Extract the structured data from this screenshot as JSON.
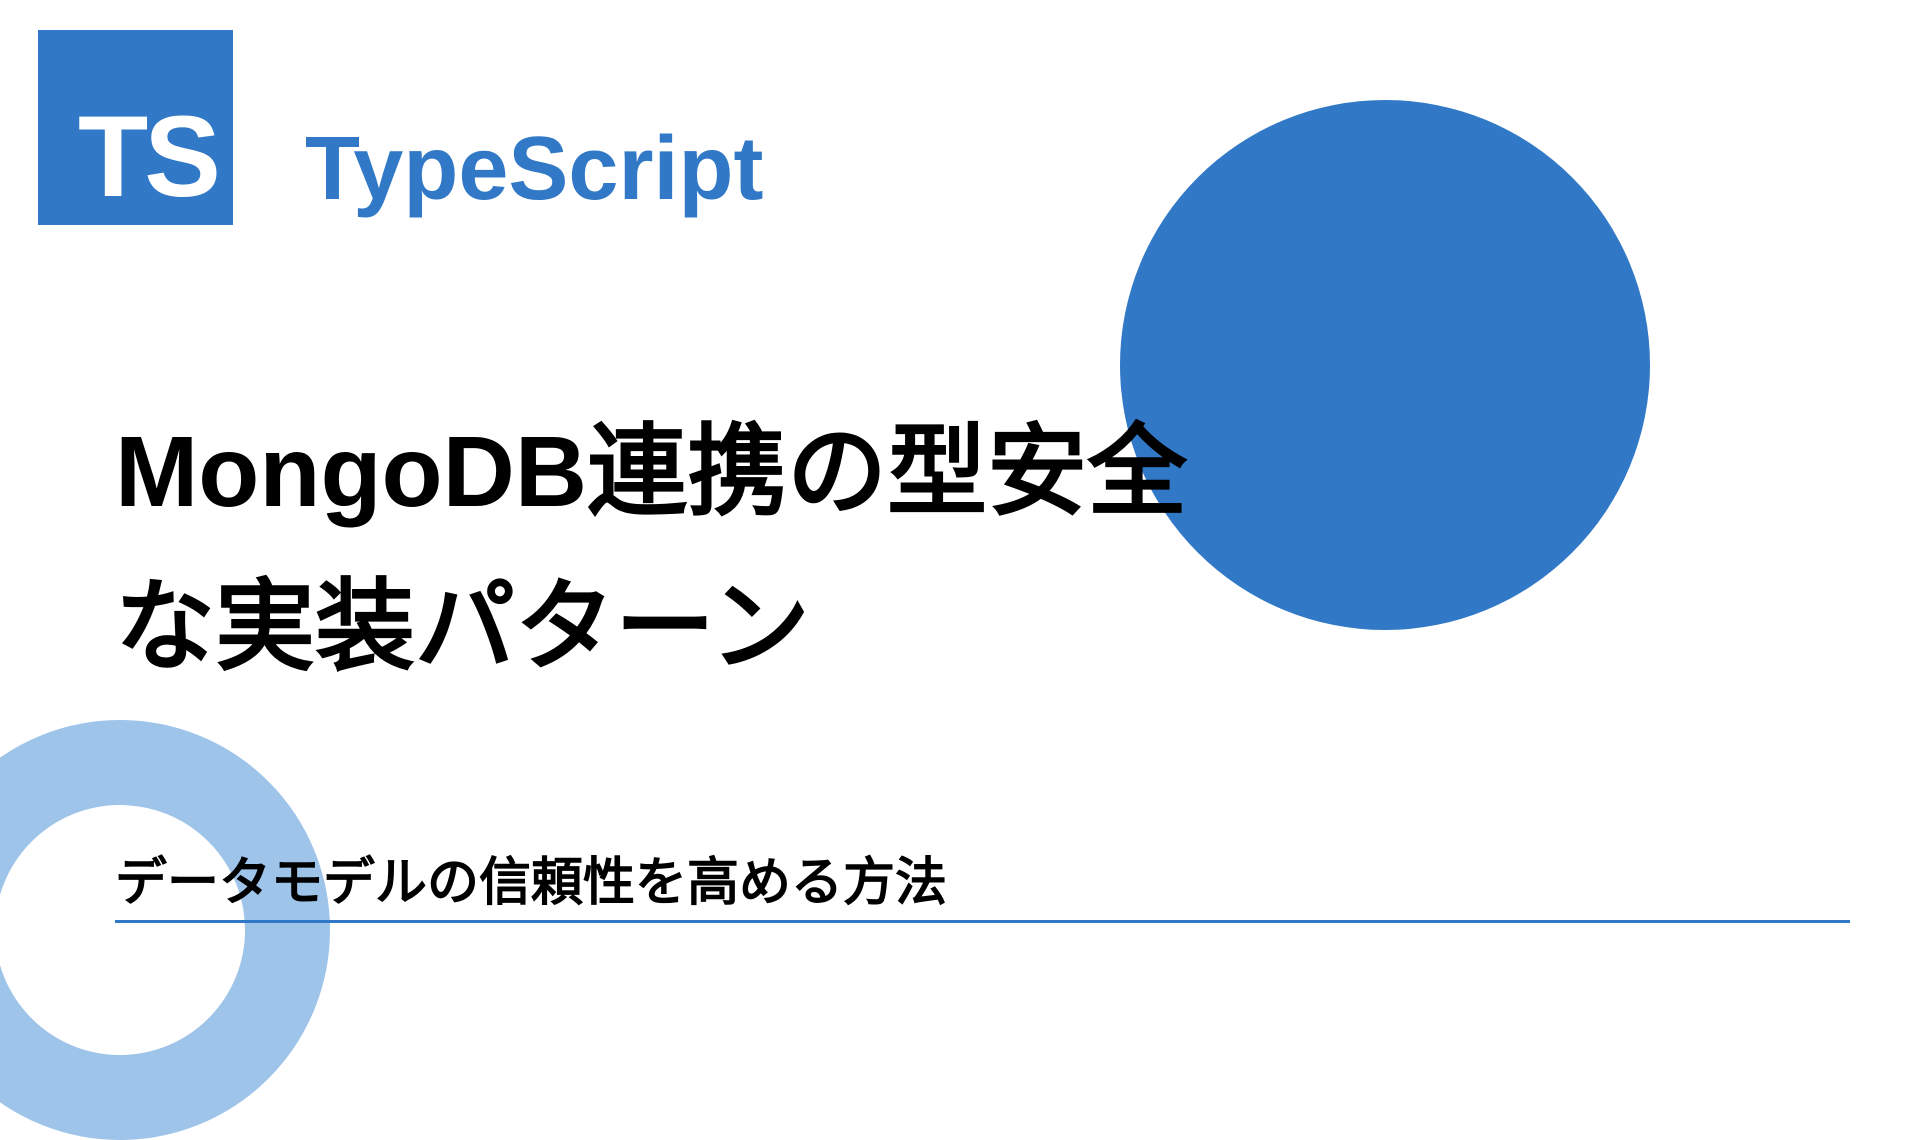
{
  "badge": {
    "text": "TS"
  },
  "brand": "TypeScript",
  "title_line1": "MongoDB連携の型安全",
  "title_line2": "な実装パターン",
  "subtitle": "データモデルの信頼性を高める方法",
  "colors": {
    "primary": "#3178c6",
    "ring": "#9ec4ea"
  }
}
